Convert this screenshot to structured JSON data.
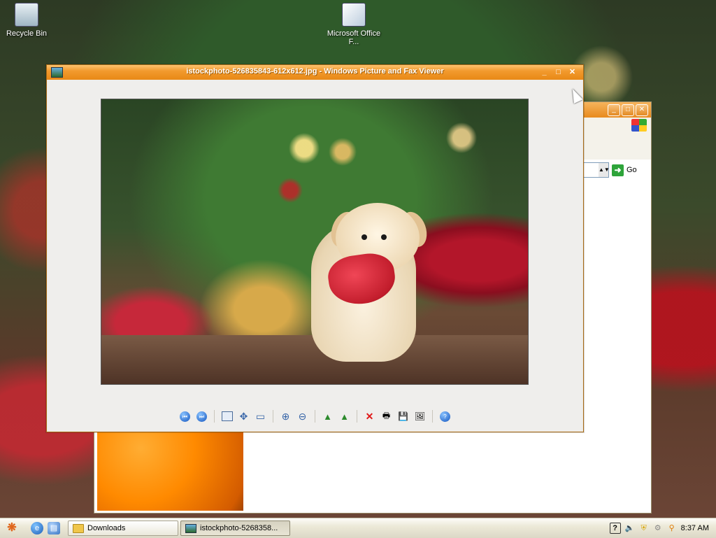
{
  "desktop": {
    "icons": [
      {
        "label": "Recycle Bin"
      },
      {
        "label": "Microsoft Office F..."
      }
    ]
  },
  "background_window": {
    "go_label": "Go",
    "buttons": {
      "minimize": "_",
      "maximize": "□",
      "close": "✕"
    }
  },
  "window": {
    "title": "istockphoto-526835843-612x612.jpg - Windows Picture and Fax Viewer",
    "buttons": {
      "minimize": "_",
      "maximize": "□",
      "close": "✕"
    },
    "toolbar": {
      "previous": "⏮",
      "next": "⏭",
      "best_fit": "▣",
      "actual_size": "✥",
      "slideshow": "▭",
      "zoom_in": "⊕",
      "zoom_out": "⊖",
      "rotate_cw": "▲",
      "rotate_ccw": "▲",
      "delete": "✕",
      "print": "🖶",
      "save": "💾",
      "open_with": "🖼",
      "help": "?"
    }
  },
  "taskbar": {
    "tasks": [
      {
        "label": "Downloads",
        "active": false
      },
      {
        "label": "istockphoto-5268358...",
        "active": true
      }
    ],
    "clock": "8:37 AM",
    "tray_icons": [
      "help-icon",
      "volume-icon",
      "security-icon",
      "network-icon",
      "search-icon"
    ]
  }
}
